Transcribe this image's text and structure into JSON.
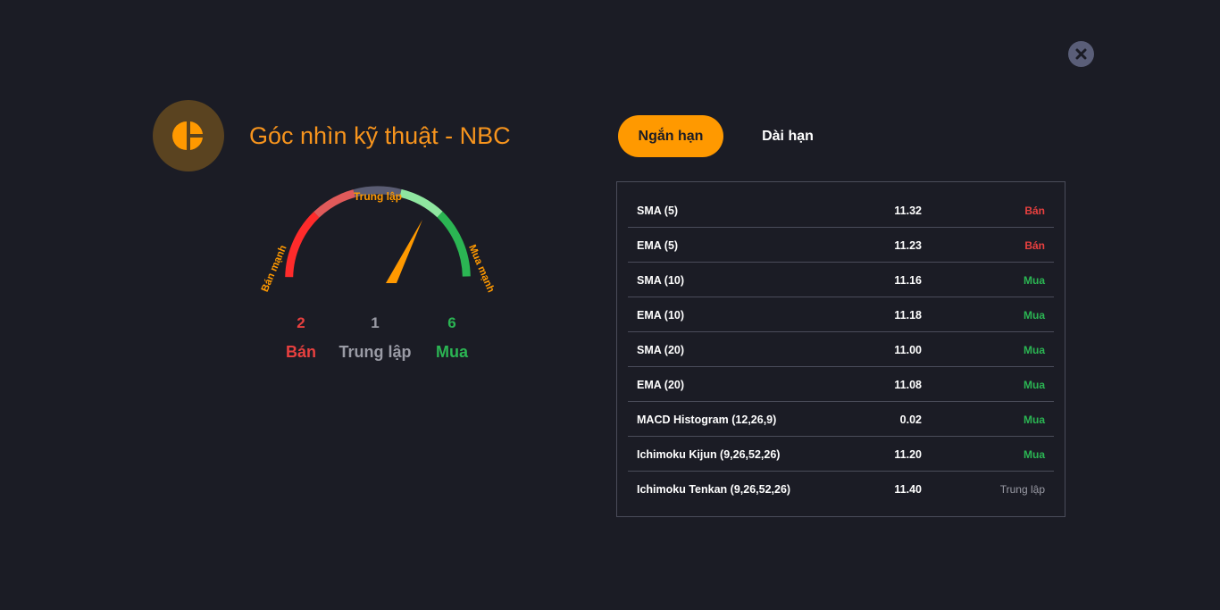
{
  "header": {
    "title": "Góc nhìn kỹ thuật - NBC",
    "logo_icon": "pie-chart-icon",
    "close_icon": "close-icon"
  },
  "gauge": {
    "label_left": "Bán mạnh",
    "label_top": "Trung lập",
    "label_right": "Mua mạnh",
    "needle_value": 0.68,
    "colors": {
      "strong_sell": "#ff2b2b",
      "sell": "#e05a5a",
      "neutral": "#5a5c73",
      "buy": "#8fe6a0",
      "strong_buy": "#2bb553",
      "needle": "#ff9900"
    }
  },
  "summary": {
    "sell_count": "2",
    "sell_label": "Bán",
    "neutral_count": "1",
    "neutral_label": "Trung lập",
    "buy_count": "6",
    "buy_label": "Mua"
  },
  "tabs": [
    {
      "label": "Ngắn hạn",
      "active": true
    },
    {
      "label": "Dài hạn",
      "active": false
    }
  ],
  "indicators": [
    {
      "name": "SMA (5)",
      "value": "11.32",
      "signal": "Bán",
      "type": "ban"
    },
    {
      "name": "EMA (5)",
      "value": "11.23",
      "signal": "Bán",
      "type": "ban"
    },
    {
      "name": "SMA (10)",
      "value": "11.16",
      "signal": "Mua",
      "type": "mua"
    },
    {
      "name": "EMA (10)",
      "value": "11.18",
      "signal": "Mua",
      "type": "mua"
    },
    {
      "name": "SMA (20)",
      "value": "11.00",
      "signal": "Mua",
      "type": "mua"
    },
    {
      "name": "EMA (20)",
      "value": "11.08",
      "signal": "Mua",
      "type": "mua"
    },
    {
      "name": "MACD Histogram (12,26,9)",
      "value": "0.02",
      "signal": "Mua",
      "type": "mua"
    },
    {
      "name": "Ichimoku Kijun (9,26,52,26)",
      "value": "11.20",
      "signal": "Mua",
      "type": "mua"
    },
    {
      "name": "Ichimoku Tenkan (9,26,52,26)",
      "value": "11.40",
      "signal": "Trung lập",
      "type": "trung"
    }
  ]
}
